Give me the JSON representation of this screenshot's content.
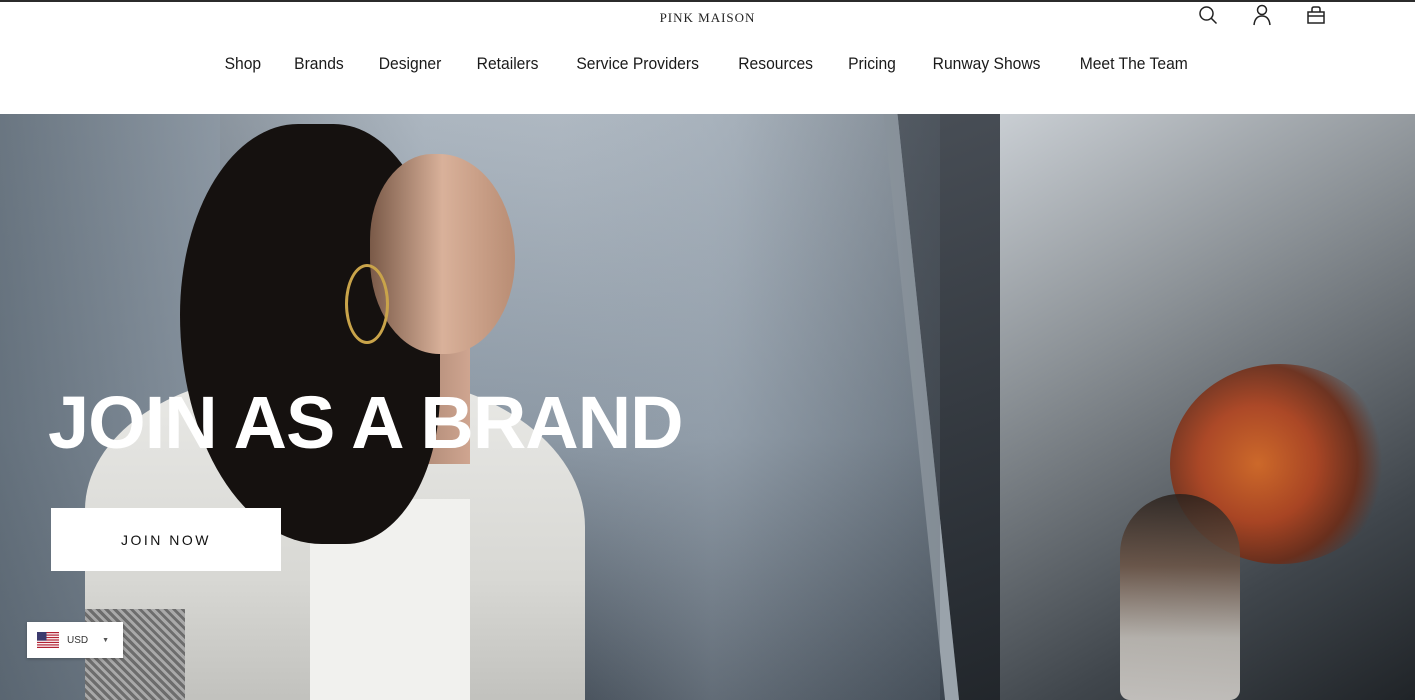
{
  "header": {
    "logo_text": "PINK MAISON",
    "icons": [
      "search-icon",
      "account-icon",
      "cart-icon"
    ]
  },
  "nav": {
    "items": [
      {
        "label": "Shop"
      },
      {
        "label": "Brands"
      },
      {
        "label": "Designer"
      },
      {
        "label": "Retailers"
      },
      {
        "label": "Service Providers"
      },
      {
        "label": "Resources"
      },
      {
        "label": "Pricing"
      },
      {
        "label": "Runway Shows"
      },
      {
        "label": "Meet The Team"
      }
    ]
  },
  "hero": {
    "title": "JOIN AS A BRAND",
    "button_label": "JOIN NOW"
  },
  "currency": {
    "code": "USD",
    "flag_icon": "us-flag-icon"
  },
  "colors": {
    "text": "#1a1a1a",
    "hero_title": "#ffffff",
    "button_bg": "#ffffff"
  }
}
